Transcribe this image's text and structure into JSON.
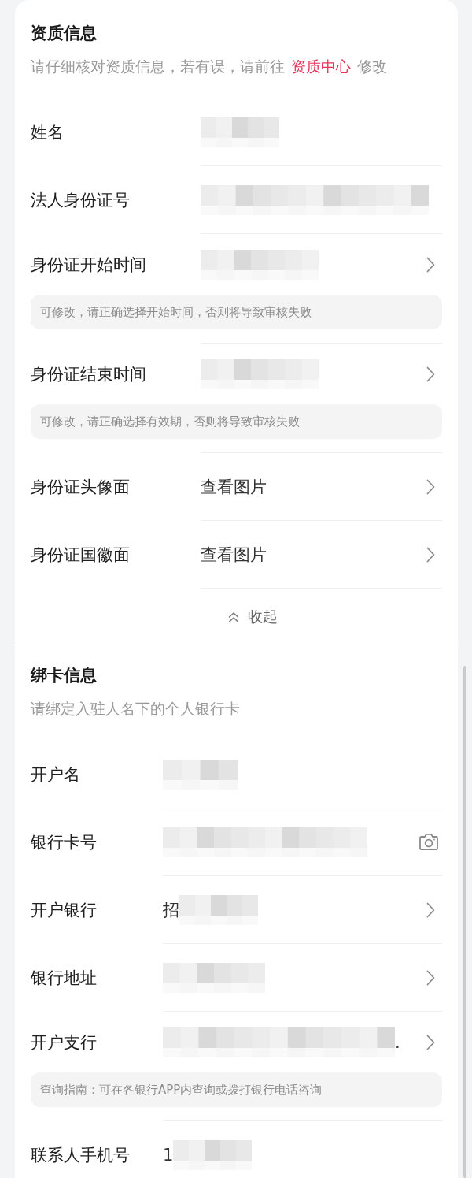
{
  "sections": [
    {
      "title": "资质信息",
      "subtitle": {
        "text_before": "请仔细核对资质信息，若有误，请前往",
        "link": "资质中心",
        "text_after": "修改"
      },
      "rows": [
        {
          "kind": "plain",
          "label": "姓名",
          "masked": true
        },
        {
          "kind": "plain",
          "label": "法人身份证号",
          "masked": true
        },
        {
          "kind": "select",
          "label": "身份证开始时间",
          "masked": true,
          "hint": "可修改，请正确选择开始时间，否则将导致审核失败"
        },
        {
          "kind": "select",
          "label": "身份证结束时间",
          "masked": true,
          "hint": "可修改，请正确选择有效期，否则将导致审核失败"
        },
        {
          "kind": "select",
          "label": "身份证头像面",
          "value": "查看图片"
        },
        {
          "kind": "select",
          "label": "身份证国徽面",
          "value": "查看图片"
        }
      ],
      "collapse": "收起"
    },
    {
      "title": "绑卡信息",
      "subtitle": {
        "text_before": "请绑定入驻人名下的个人银行卡"
      },
      "rows": [
        {
          "kind": "plain",
          "label": "开户名",
          "masked": true
        },
        {
          "kind": "scan",
          "label": "银行卡号",
          "masked": true
        },
        {
          "kind": "select",
          "label": "开户银行",
          "value_prefix": "招",
          "masked": true
        },
        {
          "kind": "select",
          "label": "银行地址",
          "masked": true
        },
        {
          "kind": "select",
          "label": "开户支行",
          "masked": true,
          "value_suffix": ".",
          "hint": "查询指南：可在各银行APP内查询或拨打银行电话咨询"
        },
        {
          "kind": "plain",
          "label": "联系人手机号",
          "value_prefix": "1",
          "masked": true
        }
      ]
    }
  ]
}
